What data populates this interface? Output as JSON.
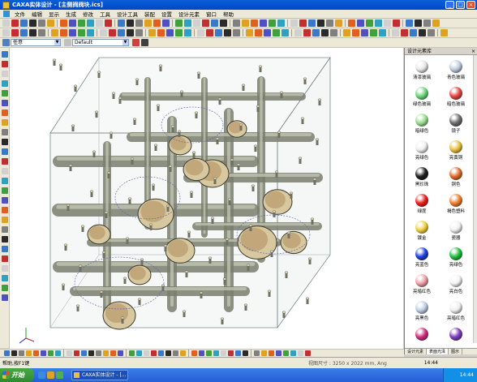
{
  "window": {
    "title": "CAXA实体设计 - [主侧阀阀块.ics]"
  },
  "menubar": {
    "items": [
      "文件",
      "编辑",
      "显示",
      "生成",
      "修改",
      "工具",
      "设计工具",
      "装配",
      "设置",
      "设计元素",
      "窗口",
      "帮助"
    ]
  },
  "toolbar": {
    "filter_value": "任意",
    "style_value": "Default"
  },
  "design_library": {
    "title": "设计元素库",
    "materials": [
      {
        "label": "清漆玻璃",
        "color": "#e8e8e8"
      },
      {
        "label": "青色玻璃",
        "color": "#c0cce0"
      },
      {
        "label": "绿色玻璃",
        "color": "#6cd87a"
      },
      {
        "label": "暗色玻璃",
        "color": "#e84848"
      },
      {
        "label": "暗绿色",
        "color": "#9ae090"
      },
      {
        "label": "镜子",
        "color": "#707070"
      },
      {
        "label": "亮绿色",
        "color": "#f0f0f0"
      },
      {
        "label": "亮黄铜",
        "color": "#e8c040"
      },
      {
        "label": "黑珍珠",
        "color": "#202020"
      },
      {
        "label": "铜色",
        "color": "#e07030"
      },
      {
        "label": "绿度",
        "color": "#f02020"
      },
      {
        "label": "褐色塑料",
        "color": "#f08030"
      },
      {
        "label": "镀金",
        "color": "#f0d040"
      },
      {
        "label": "瓷器",
        "color": "#f0f0f0"
      },
      {
        "label": "亮蓝色",
        "color": "#2040e0"
      },
      {
        "label": "亮绿色",
        "color": "#20c040"
      },
      {
        "label": "亮暗红色",
        "color": "#f0a0a8"
      },
      {
        "label": "亮白色",
        "color": "#f4f4f4"
      },
      {
        "label": "亮黑色",
        "color": "#c0d0e8"
      },
      {
        "label": "亮暗红色",
        "color": "#f0f0f0"
      },
      {
        "label": "",
        "color": "#d03080"
      },
      {
        "label": "",
        "color": "#8040c0"
      }
    ],
    "tabs": [
      "设计元素",
      "表面光泽",
      "图示"
    ]
  },
  "statusbar": {
    "left_text": "帮助,按F1键",
    "coords": "视图尺寸 : 3250 x 2022   mm, Ang",
    "time": "14:44"
  },
  "taskbar": {
    "start_label": "开始",
    "task_label": "CAXA实体设计 - [..."
  }
}
